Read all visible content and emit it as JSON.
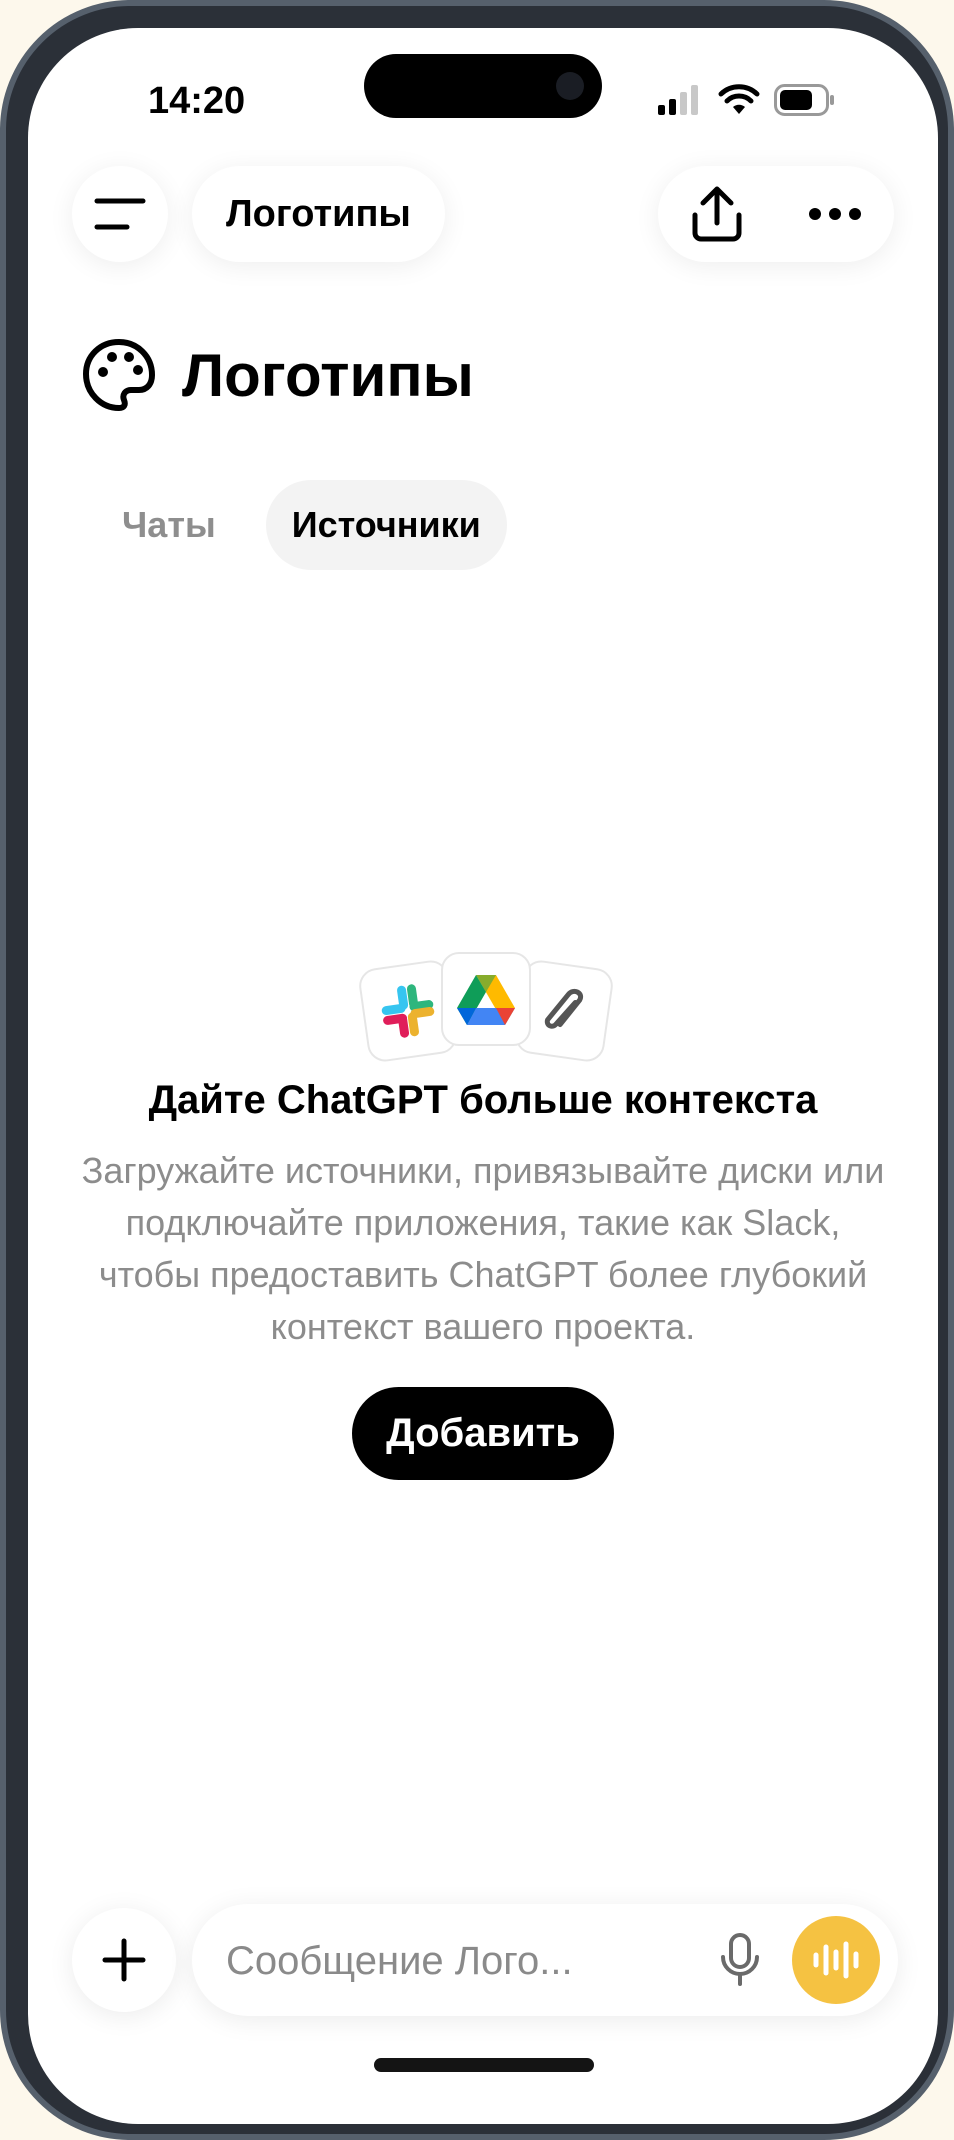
{
  "status_bar": {
    "time": "14:20"
  },
  "header": {
    "title_pill": "Логотипы",
    "icons": [
      "menu-icon",
      "share-icon",
      "more-icon"
    ]
  },
  "project": {
    "title": "Логотипы",
    "icon": "palette-icon"
  },
  "tabs": [
    {
      "label": "Чаты",
      "active": false
    },
    {
      "label": "Источники",
      "active": true
    }
  ],
  "empty_state": {
    "logos": [
      "slack-logo",
      "google-drive-logo",
      "paperclip-icon"
    ],
    "title": "Дайте ChatGPT больше контекста",
    "description": "Загружайте источники, привязывайте диски или подключайте приложения, такие как Slack, чтобы предоставить ChatGPT более глубокий контекст вашего проекта.",
    "button_label": "Добавить"
  },
  "composer": {
    "placeholder": "Сообщение Лого...",
    "icons": [
      "plus-icon",
      "microphone-icon",
      "voice-mode-icon"
    ]
  },
  "colors": {
    "voice_button": "#f5c242",
    "primary_button": "#000000",
    "muted_text": "#8c8c8c"
  }
}
